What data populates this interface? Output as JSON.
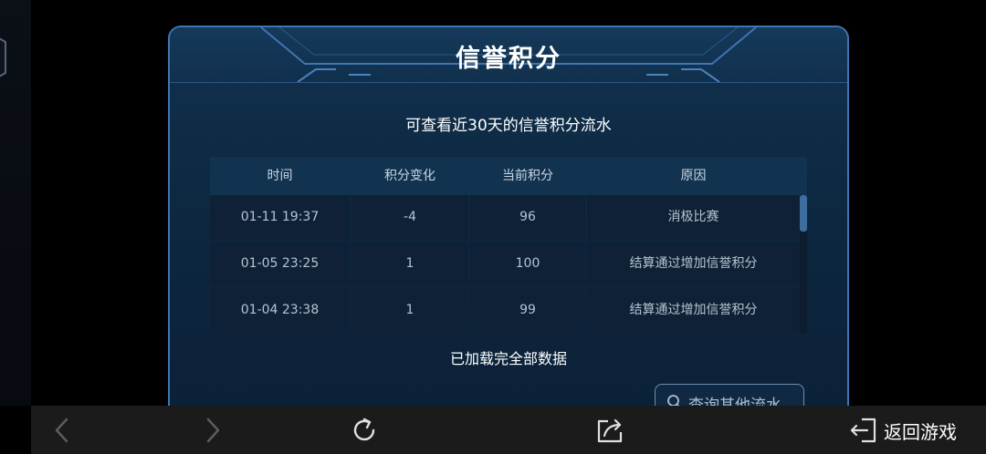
{
  "panel": {
    "title": "信誉积分",
    "subtitle": "可查看近30天的信誉积分流水",
    "loaded_note": "已加载完全部数据",
    "query_button": "查询其他流水"
  },
  "table": {
    "headers": [
      "时间",
      "积分变化",
      "当前积分",
      "原因"
    ],
    "rows": [
      [
        "01-11  19:37",
        "-4",
        "96",
        "消极比赛"
      ],
      [
        "01-05  23:25",
        "1",
        "100",
        "结算通过增加信誉积分"
      ],
      [
        "01-04  23:38",
        "1",
        "99",
        "结算通过增加信誉积分"
      ]
    ]
  },
  "bottom_bar": {
    "back_to_game": "返回游戏"
  },
  "icons": {
    "back": "chevron-left-icon",
    "forward": "chevron-right-icon",
    "refresh": "refresh-icon",
    "share": "share-icon",
    "exit": "exit-icon",
    "search": "search-icon"
  },
  "colors": {
    "panel_border": "#3f75b0",
    "panel_bg": "#0d2841",
    "header_row_bg": "#123350",
    "cell_bg": "#0f2136",
    "bar_bg": "#1b1b1b"
  }
}
